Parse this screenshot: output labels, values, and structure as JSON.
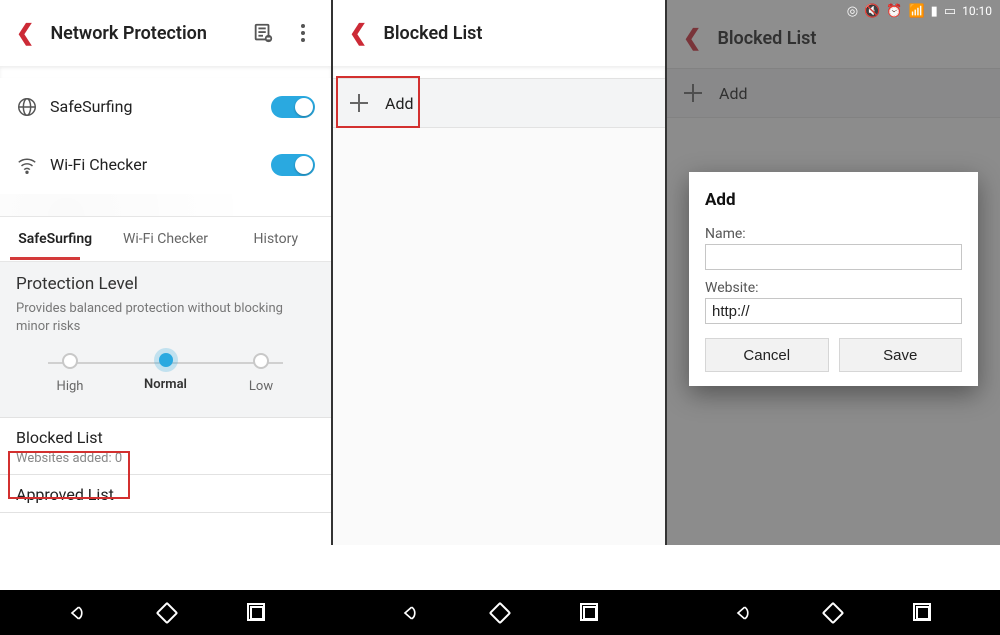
{
  "status": {
    "time": "10:10"
  },
  "p1": {
    "title": "Network Protection",
    "features": [
      {
        "label": "SafeSurfing",
        "on": true
      },
      {
        "label": "Wi-Fi Checker",
        "on": true
      }
    ],
    "tabs": [
      "SafeSurfing",
      "Wi-Fi Checker",
      "History"
    ],
    "protection": {
      "title": "Protection Level",
      "desc": "Provides balanced protection without blocking minor risks",
      "levels": [
        "High",
        "Normal",
        "Low"
      ],
      "selected": "Normal"
    },
    "blocked": {
      "title": "Blocked List",
      "sub": "Websites added: 0"
    },
    "approved": {
      "title": "Approved List"
    }
  },
  "p2": {
    "title": "Blocked List",
    "add": "Add"
  },
  "p3": {
    "title": "Blocked List",
    "add": "Add",
    "dialog": {
      "title": "Add",
      "name_label": "Name:",
      "name_value": "",
      "site_label": "Website:",
      "site_value": "http://",
      "cancel": "Cancel",
      "save": "Save"
    }
  }
}
